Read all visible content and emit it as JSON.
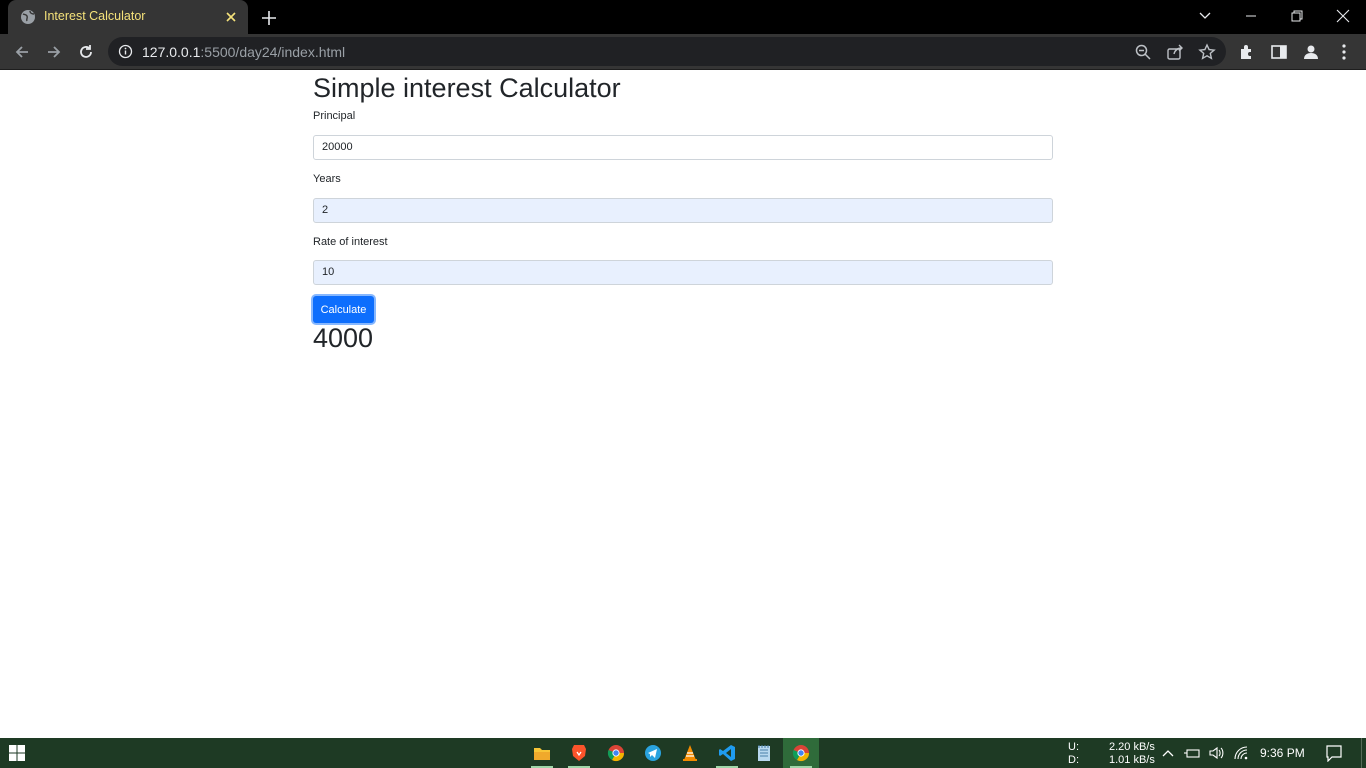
{
  "browser": {
    "tab_title": "Interest Calculator",
    "url_host": "127.0.0.1",
    "url_rest": ":5500/day24/index.html"
  },
  "page": {
    "title": "Simple interest Calculator",
    "fields": [
      {
        "label": "Principal",
        "value": "20000"
      },
      {
        "label": "Years",
        "value": "2"
      },
      {
        "label": "Rate of interest",
        "value": "10"
      }
    ],
    "button_label": "Calculate",
    "result": "4000"
  },
  "taskbar": {
    "apps": [
      "file-explorer-icon",
      "brave-icon",
      "chrome-icon",
      "telegram-icon",
      "vlc-icon",
      "vscode-icon",
      "notepad-icon",
      "chrome-active-icon"
    ],
    "upload_label": "U:",
    "download_label": "D:",
    "upload_speed": "2.20 kB/s",
    "download_speed": "1.01 kB/s",
    "clock": "9:36 PM"
  },
  "colors": {
    "accent": "#0d6efd",
    "autofill": "#e8f0fe",
    "taskbar": "#1e3a24"
  }
}
